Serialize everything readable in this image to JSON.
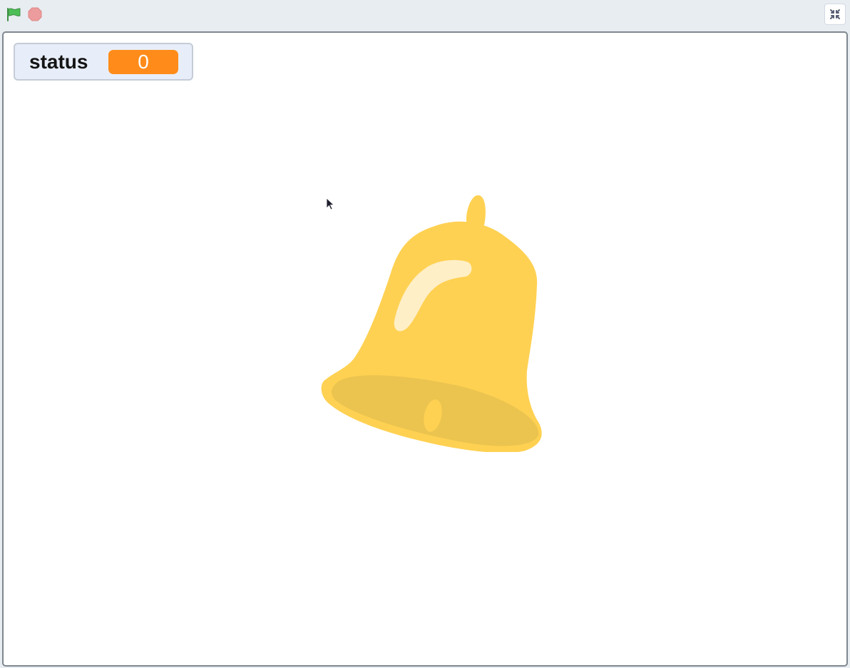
{
  "toolbar": {
    "green_flag_icon": "green-flag-icon",
    "stop_icon": "stop-sign-icon",
    "fullscreen_icon": "exit-fullscreen-icon"
  },
  "stage": {
    "monitor": {
      "label": "status",
      "value": "0"
    },
    "sprite": {
      "name_icon": "bell-icon"
    }
  },
  "colors": {
    "flag_green": "#4cbf56",
    "stop_red": "#ec9c9c",
    "monitor_value_bg": "#ff8c1a",
    "bell_body": "#ffd152",
    "bell_inner": "#ebc44f",
    "bell_highlight": "#ffefc7"
  }
}
